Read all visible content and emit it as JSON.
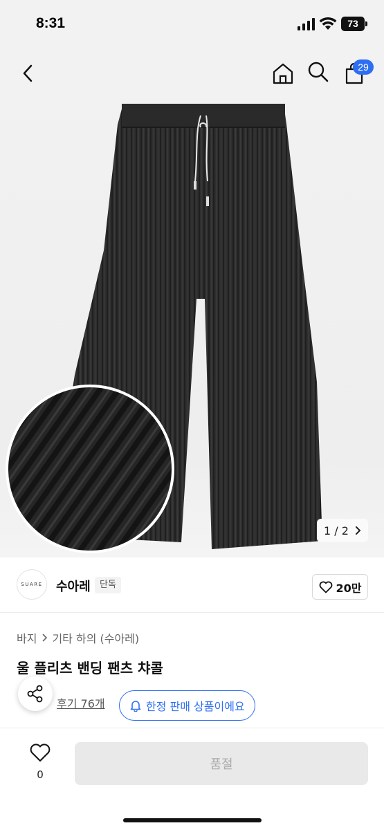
{
  "status": {
    "time": "8:31",
    "battery": "73"
  },
  "header": {
    "cart_count": "29"
  },
  "gallery": {
    "counter": "1 / 2"
  },
  "brand": {
    "logo_text": "SUARE",
    "name": "수아레",
    "tag": "단독",
    "likes": "20만"
  },
  "breadcrumb": {
    "category": "바지",
    "subcategory": "기타 하의 (수아레)"
  },
  "product": {
    "title": "울 플리츠 밴딩 팬츠 챠콜"
  },
  "review": {
    "label": "후기 76개",
    "limited_label": "한정 판매 상품이에요"
  },
  "bottom": {
    "wish_count": "0",
    "buy_label": "품절"
  }
}
